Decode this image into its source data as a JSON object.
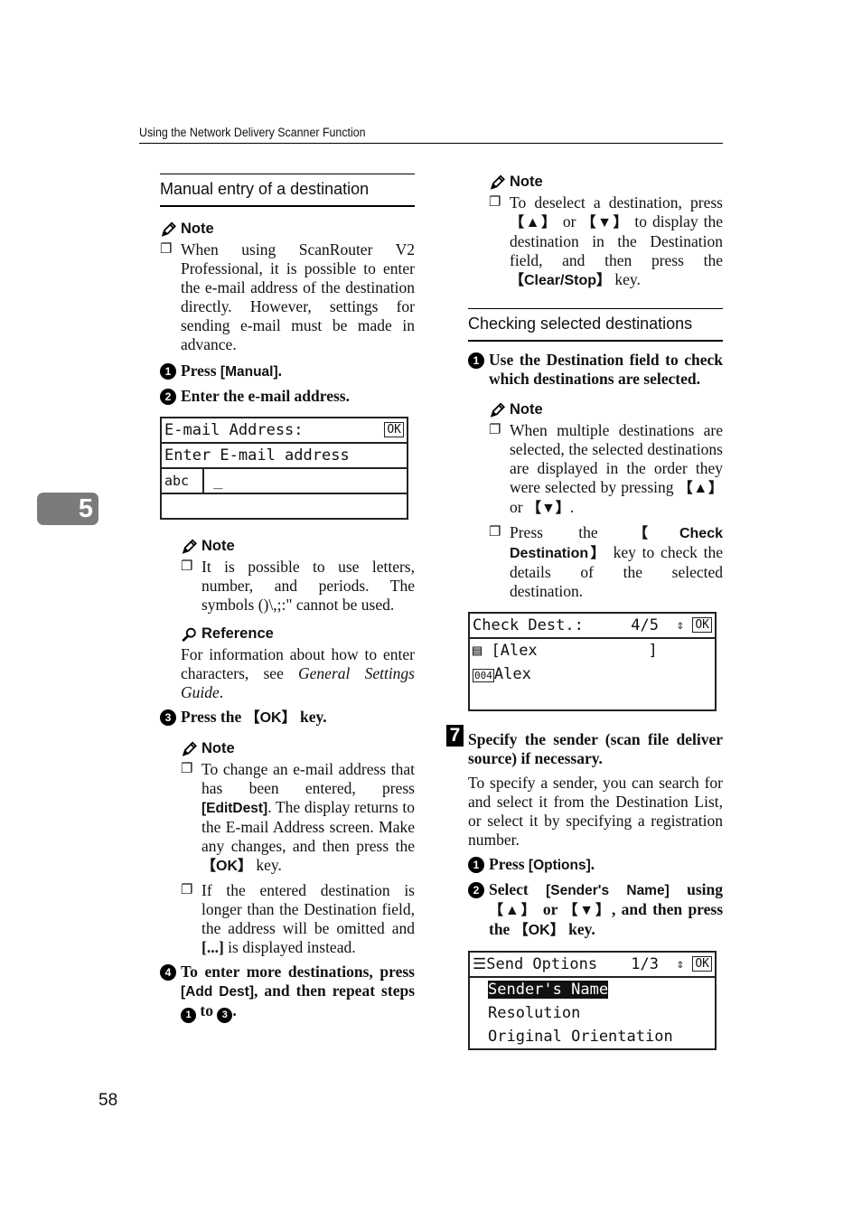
{
  "header": {
    "running_title": "Using the Network Delivery Scanner Function"
  },
  "chapter_tab": "5",
  "page_number": "58",
  "left": {
    "section_title": "Manual entry of a destination",
    "note_label": "Note",
    "reference_label": "Reference",
    "note1": "When using ScanRouter V2 Professional, it is possible to enter the e-mail address of the destination directly. However, settings for sending e-mail must be made in advance.",
    "step1_num": "1",
    "step1_pre": "Press ",
    "step1_key": "[Manual]",
    "step1_post": ".",
    "step2_num": "2",
    "step2": "Enter the e-mail address.",
    "lcd_email": {
      "title": "E-mail Address:",
      "ok": "OK",
      "prompt": "Enter E-mail address",
      "mode": "abc",
      "cursor": "_"
    },
    "note2": "It is possible to use letters, number, and periods. The symbols ()\\,;:\" cannot be used.",
    "reference_pre": "For information about how to enter characters, see ",
    "reference_italic": "General Settings Guide",
    "reference_post": ".",
    "step3_num": "3",
    "step3_pre": "Press the ",
    "step3_key": "【OK】",
    "step3_post": " key.",
    "note3_pre": "To change an e-mail address that has been entered, press ",
    "note3_key": "[EditDest]",
    "note3_mid": ". The display returns to the E-mail Address screen. Make any changes, and then press the ",
    "note3_key2": "【OK】",
    "note3_post": " key.",
    "note4_pre": "If the entered destination is longer than the Destination field, the address will be omitted and ",
    "note4_key": "[...]",
    "note4_post": " is displayed instead.",
    "step4_num": "4",
    "step4_pre": "To enter more destinations, press ",
    "step4_key": "[Add Dest]",
    "step4_mid": ", and then repeat steps ",
    "step4_ref1": "1",
    "step4_to": " to ",
    "step4_ref2": "3",
    "step4_post": "."
  },
  "right": {
    "note_label": "Note",
    "note1_pre": "To deselect a destination, press ",
    "up_key": "【▲】",
    "or": " or ",
    "down_key": "【▼】",
    "note1_mid": " to display the destination in the Destination field, and then press the ",
    "note1_key": "【Clear/Stop】",
    "note1_post": " key.",
    "section_title": "Checking selected destinations",
    "step1_num": "1",
    "step1": "Use the Destination field to check which destinations are selected.",
    "note2_pre": "When multiple destinations are selected, the selected destinations are displayed in the order they were selected by pressing ",
    "note2_post": ".",
    "note3_pre": "Press the ",
    "note3_key": "【Check Destination】",
    "note3_post": " key to check the details of the selected destination.",
    "lcd_check": {
      "title": "Check Dest.:",
      "counter": "4/5",
      "updown": "⇕",
      "ok": "OK",
      "dest_line": " [Alex            ]",
      "reg_no": "004",
      "name": "Alex"
    },
    "step7_num": "7",
    "step7": "Specify the sender (scan file deliver source) if necessary.",
    "step7_body": "To specify a sender, you can search for and select it from the Destination List, or select it by specifying a registration number.",
    "sub1_num": "1",
    "sub1_pre": "Press ",
    "sub1_key": "[Options]",
    "sub1_post": ".",
    "sub2_num": "2",
    "sub2_pre": "Select ",
    "sub2_key": "[Sender's Name]",
    "sub2_mid": " using ",
    "sub2_mid2": ", and then press the ",
    "sub2_key2": "【OK】",
    "sub2_post": " key.",
    "lcd_send": {
      "title": "Send Options",
      "counter": "1/3",
      "updown": "⇕",
      "ok": "OK",
      "items": [
        "Sender's Name",
        "Resolution",
        "Original Orientation"
      ],
      "selected_index": 0
    }
  }
}
